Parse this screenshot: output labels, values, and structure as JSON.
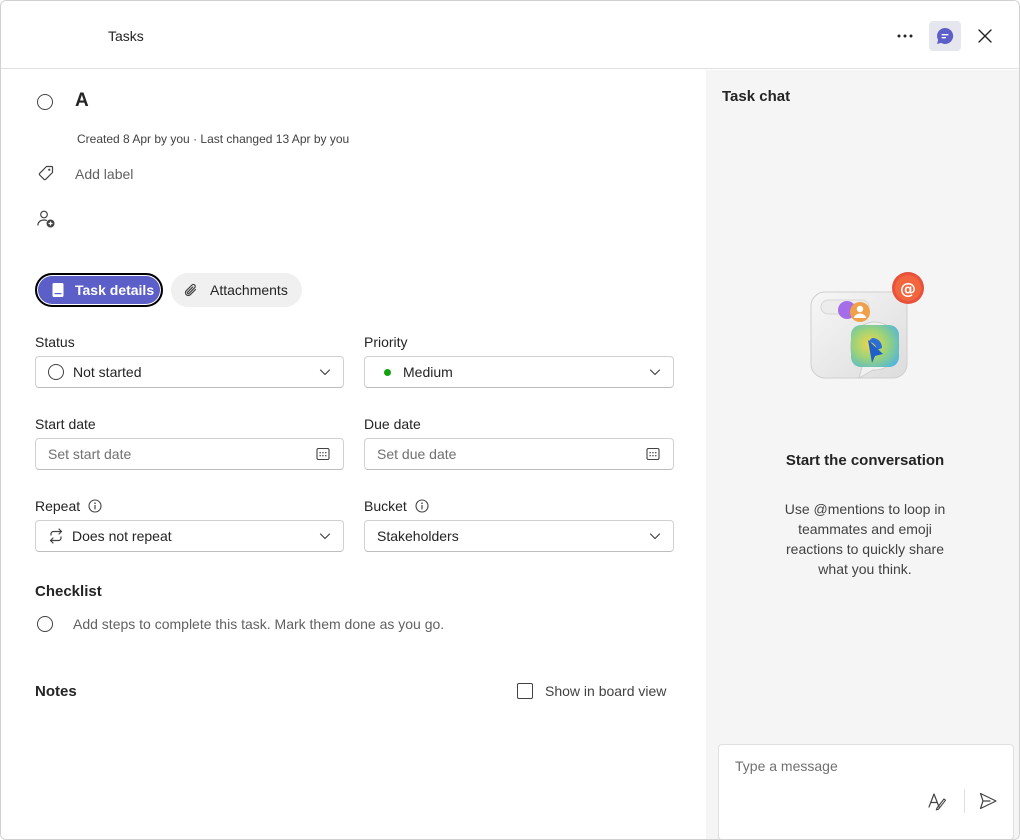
{
  "header": {
    "app_title": "Tasks"
  },
  "task": {
    "title": "A",
    "meta": "Created 8 Apr by you · Last changed 13 Apr by you",
    "add_label": "Add label"
  },
  "tabs": {
    "details": "Task details",
    "attachments": "Attachments"
  },
  "fields": {
    "status_label": "Status",
    "status_value": "Not started",
    "priority_label": "Priority",
    "priority_value": "Medium",
    "priority_color": "#13a10e",
    "start_label": "Start date",
    "start_placeholder": "Set start date",
    "due_label": "Due date",
    "due_placeholder": "Set due date",
    "repeat_label": "Repeat",
    "repeat_value": "Does not repeat",
    "bucket_label": "Bucket",
    "bucket_value": "Stakeholders"
  },
  "checklist": {
    "title": "Checklist",
    "placeholder": "Add steps to complete this task. Mark them done as you go."
  },
  "notes": {
    "title": "Notes",
    "board_view_label": "Show in board view"
  },
  "chat": {
    "title": "Task chat",
    "empty_title": "Start the conversation",
    "empty_description": "Use @mentions to loop in teammates and emoji reactions to quickly share what you think.",
    "compose_placeholder": "Type a message"
  },
  "colors": {
    "accent": "#5b5fc7",
    "chat_panel_bg": "#f5f5f5"
  },
  "icons": {
    "more": "more-horizontal-icon",
    "chat": "chat-icon",
    "close": "close-icon",
    "tag": "tag-icon",
    "assign": "person-add-icon",
    "notebook": "notebook-icon",
    "attach": "paperclip-icon",
    "calendar": "calendar-icon",
    "info": "info-icon",
    "repeat": "repeat-icon",
    "chevron": "chevron-down-icon",
    "format": "text-format-icon",
    "send": "send-icon"
  }
}
